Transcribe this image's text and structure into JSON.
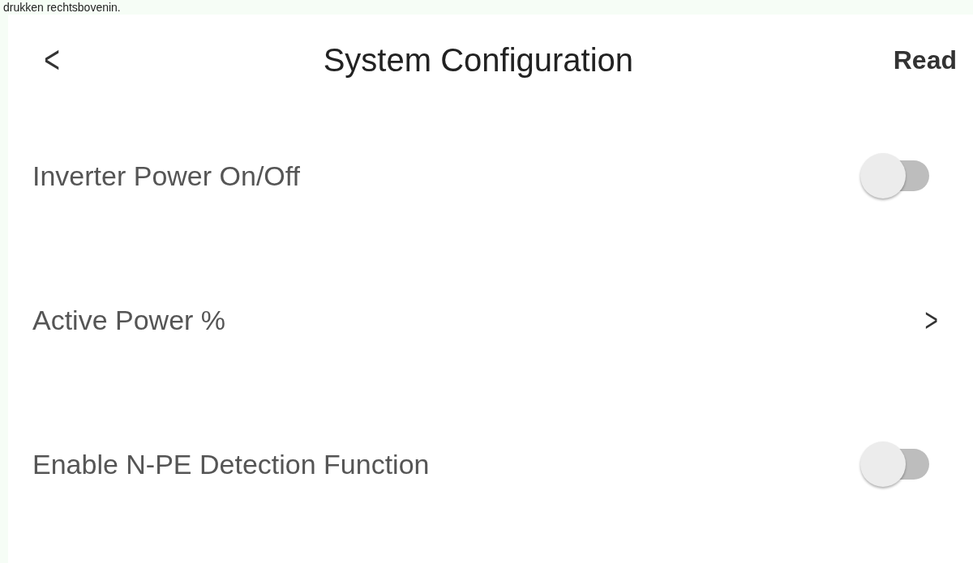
{
  "top_note": "drukken rechtsbovenin.",
  "header": {
    "back": "<",
    "title": "System Configuration",
    "action": "Read"
  },
  "rows": [
    {
      "kind": "toggle",
      "label": "Inverter Power On/Off",
      "on": false
    },
    {
      "kind": "link",
      "label": "Active Power %",
      "chevron": ">"
    },
    {
      "kind": "toggle",
      "label": "Enable N-PE Detection Function",
      "on": false
    }
  ]
}
